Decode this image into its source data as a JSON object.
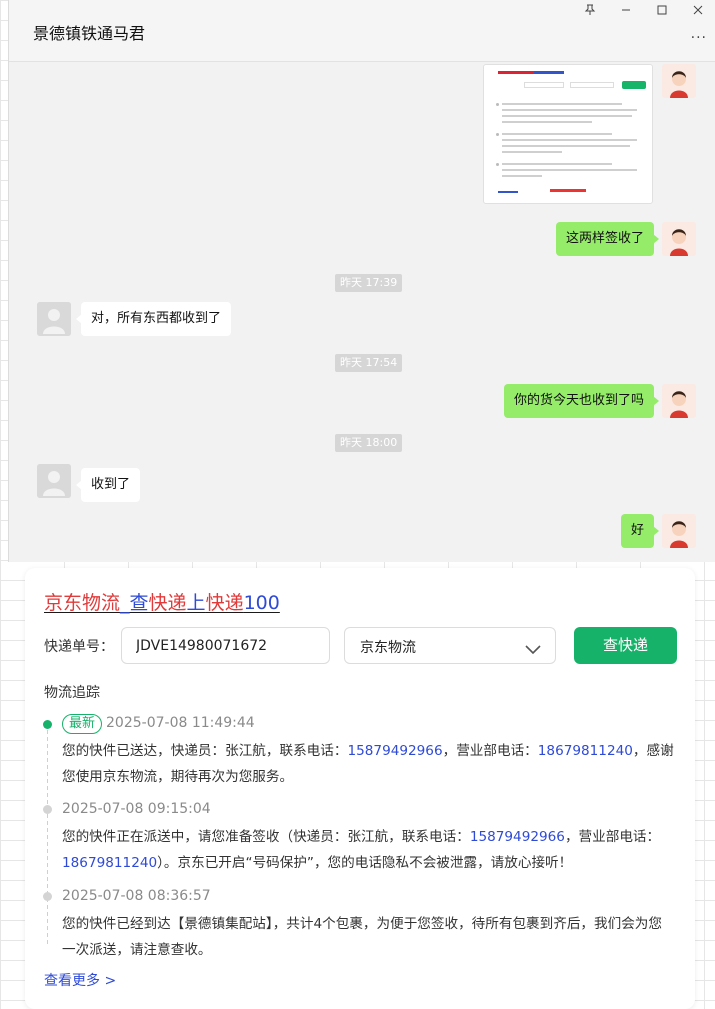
{
  "chat": {
    "title": "景德镇铁通马君",
    "window_controls": [
      "pin-icon",
      "minimize-icon",
      "maximize-icon",
      "close-icon"
    ],
    "more_label": "...",
    "messages": [
      {
        "side": "me",
        "type": "image"
      },
      {
        "side": "me",
        "text": "这两样签收了"
      },
      {
        "side": "time",
        "text": "昨天 17:39"
      },
      {
        "side": "other",
        "text": "对，所有东西都收到了"
      },
      {
        "side": "time",
        "text": "昨天 17:54"
      },
      {
        "side": "me",
        "text": "你的货今天也收到了吗"
      },
      {
        "side": "time",
        "text": "昨天 18:00"
      },
      {
        "side": "other",
        "text": "收到了"
      },
      {
        "side": "me",
        "text": "好"
      }
    ]
  },
  "tracking": {
    "title_parts": [
      "京东物流",
      "_查",
      "快递",
      "上",
      "快递",
      "100"
    ],
    "number_label": "快递单号：",
    "number_value": "JDVE14980071672",
    "carrier_selected": "京东物流",
    "query_button": "查快递",
    "track_heading": "物流追踪",
    "events": [
      {
        "latest_badge": "最新",
        "time": "2025-07-08 11:49:44",
        "text_1": "您的快件已送达，快递员：张江航，联系电话：",
        "phone_1": "15879492966",
        "text_2": "，营业部电话：",
        "phone_2": "18679811240",
        "text_3": "，感谢您使用京东物流，期待再次为您服务。"
      },
      {
        "time": "2025-07-08 09:15:04",
        "text_1": "您的快件正在派送中，请您准备签收（快递员：张江航，联系电话：",
        "phone_1": "15879492966",
        "text_2": "，营业部电话：",
        "phone_2": "18679811240",
        "text_3": "）。京东已开启“号码保护”，您的电话隐私不会被泄露，请放心接听！"
      },
      {
        "time": "2025-07-08 08:36:57",
        "text_1": "您的快件已经到达【景德镇集配站】，共计4个包裹，为便于您签收，待所有包裹到齐后，我们会为您一次派送，请注意查收。"
      }
    ],
    "see_more": "查看更多 >"
  },
  "colors": {
    "my_bubble": "#95ec69",
    "accent_green": "#17b26a",
    "link_blue": "#2f4bd6",
    "title_red": "#e03a3a"
  }
}
